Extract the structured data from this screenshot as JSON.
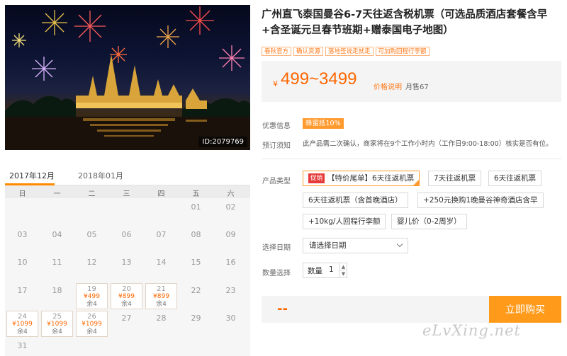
{
  "hero": {
    "image_id": "ID:2079769"
  },
  "product": {
    "title": "广州直飞泰国曼谷6-7天往返含税机票（可选品质酒店套餐含早+含圣诞元旦春节班期+赠泰国电子地图）",
    "tags": [
      "春秋官方",
      "确认资源",
      "落地签说走就走",
      "可加购回程行李额"
    ]
  },
  "price": {
    "currency_symbol": "¥",
    "range": "499~3499",
    "note": "价格说明",
    "monthly_sales": "月售67"
  },
  "promo": {
    "label": "优惠信息",
    "badge": "蜂蜜抵10%"
  },
  "booking_notice": {
    "label": "预订须知",
    "text": "此产品需二次确认，商家将在9个工作小时内（工作日9:00-18:00）核实是否有位。"
  },
  "product_type": {
    "label": "产品类型",
    "sale_badge": "促销",
    "options": [
      "【特价尾单】6天往返机票",
      "7天往返机票",
      "6天往返机票",
      "6天往返机票（含首晚酒店）",
      "+250元换购1晚曼谷神奇酒店含早",
      "+10kg/人回程行李额",
      "婴儿价（0-2周岁）"
    ]
  },
  "date_select": {
    "label": "选择日期",
    "placeholder": "请选择日期"
  },
  "quantity": {
    "label": "数量选择",
    "field_label": "数量",
    "value": "1",
    "up": "▲",
    "down": "▼"
  },
  "buy": {
    "total": "--",
    "button": "立即购买"
  },
  "calendar": {
    "tabs": [
      "2017年12月",
      "2018年01月"
    ],
    "weekdays": [
      "日",
      "一",
      "二",
      "三",
      "四",
      "五",
      "六"
    ],
    "days": [
      {
        "d": "01",
        "col": 5,
        "row": 0
      },
      {
        "d": "02",
        "col": 6,
        "row": 0
      },
      {
        "d": "03",
        "col": 0,
        "row": 1
      },
      {
        "d": "04",
        "col": 1,
        "row": 1
      },
      {
        "d": "05",
        "col": 2,
        "row": 1
      },
      {
        "d": "06",
        "col": 3,
        "row": 1
      },
      {
        "d": "07",
        "col": 4,
        "row": 1
      },
      {
        "d": "08",
        "col": 5,
        "row": 1
      },
      {
        "d": "09",
        "col": 6,
        "row": 1
      },
      {
        "d": "10",
        "col": 0,
        "row": 2
      },
      {
        "d": "11",
        "col": 1,
        "row": 2
      },
      {
        "d": "12",
        "col": 2,
        "row": 2
      },
      {
        "d": "13",
        "col": 3,
        "row": 2
      },
      {
        "d": "14",
        "col": 4,
        "row": 2
      },
      {
        "d": "15",
        "col": 5,
        "row": 2
      },
      {
        "d": "16",
        "col": 6,
        "row": 2
      },
      {
        "d": "17",
        "col": 0,
        "row": 3
      },
      {
        "d": "18",
        "col": 1,
        "row": 3
      },
      {
        "d": "19",
        "col": 2,
        "row": 3,
        "price": "¥499",
        "stock": "余4"
      },
      {
        "d": "20",
        "col": 3,
        "row": 3,
        "price": "¥899",
        "stock": "余4"
      },
      {
        "d": "21",
        "col": 4,
        "row": 3,
        "price": "¥899",
        "stock": "余4"
      },
      {
        "d": "22",
        "col": 5,
        "row": 3
      },
      {
        "d": "23",
        "col": 6,
        "row": 3
      },
      {
        "d": "24",
        "col": 0,
        "row": 4,
        "price": "¥1099",
        "stock": "余4"
      },
      {
        "d": "25",
        "col": 1,
        "row": 4,
        "price": "¥1099",
        "stock": "余4"
      },
      {
        "d": "26",
        "col": 2,
        "row": 4,
        "price": "¥1099",
        "stock": "余4"
      },
      {
        "d": "27",
        "col": 3,
        "row": 4
      },
      {
        "d": "28",
        "col": 4,
        "row": 4
      },
      {
        "d": "29",
        "col": 5,
        "row": 4
      },
      {
        "d": "30",
        "col": 6,
        "row": 4
      },
      {
        "d": "31",
        "col": 0,
        "row": 5
      }
    ]
  },
  "watermark": "eLvXing.net",
  "colors": {
    "accent": "#ff9a1a",
    "price": "#ff6600",
    "sale": "#e63b3b"
  }
}
